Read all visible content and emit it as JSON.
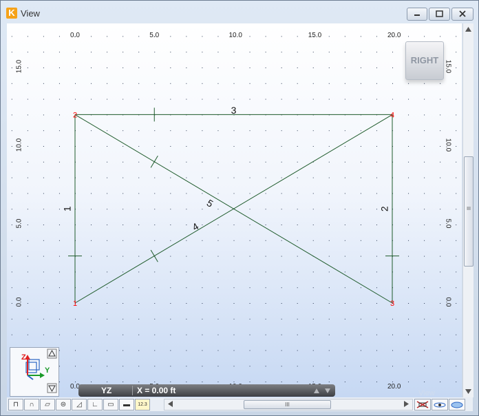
{
  "window": {
    "title": "View",
    "app_icon_letter": "K"
  },
  "viewcube": {
    "label": "RIGHT"
  },
  "status": {
    "plane": "YZ",
    "coordinate": "X = 0.00 ft"
  },
  "axes": {
    "horizontal_ticks": [
      "0.0",
      "5.0",
      "10.0",
      "15.0",
      "20.0"
    ],
    "vertical_ticks": [
      "0.0",
      "5.0",
      "10.0",
      "15.0"
    ]
  },
  "model": {
    "nodes": [
      {
        "id": "1",
        "y": 0,
        "z": 0
      },
      {
        "id": "2",
        "y": 0,
        "z": 12
      },
      {
        "id": "3",
        "y": 20,
        "z": 0
      },
      {
        "id": "4",
        "y": 20,
        "z": 12
      }
    ],
    "members": [
      {
        "id": "1",
        "from": "1",
        "to": "2"
      },
      {
        "id": "2",
        "from": "3",
        "to": "4"
      },
      {
        "id": "3",
        "from": "2",
        "to": "4"
      },
      {
        "id": "4",
        "from": "1",
        "to": "4"
      },
      {
        "id": "5",
        "from": "2",
        "to": "3"
      }
    ],
    "units": "ft"
  },
  "triad": {
    "z_label": "Z",
    "y_label": "Y"
  },
  "colors": {
    "node": "#ff0000",
    "member": "#1d5a2a",
    "grid": "#2b3a55",
    "axis_z": "#e02020",
    "axis_y": "#1a9a2a"
  },
  "toolbar": {
    "buttons": [
      "node-tool",
      "member-tool",
      "plate-tool",
      "support-tool",
      "load-tool",
      "angle-tool",
      "plane-tool",
      "section-tool",
      "label-tool"
    ],
    "right_buttons": [
      "no-display-tool",
      "rotate-tool",
      "render-tool"
    ],
    "label_123": "12.3"
  },
  "hscroll": {
    "thumb_label": "III"
  },
  "vscroll": {
    "thumb_label": "III"
  },
  "watermark": "View"
}
